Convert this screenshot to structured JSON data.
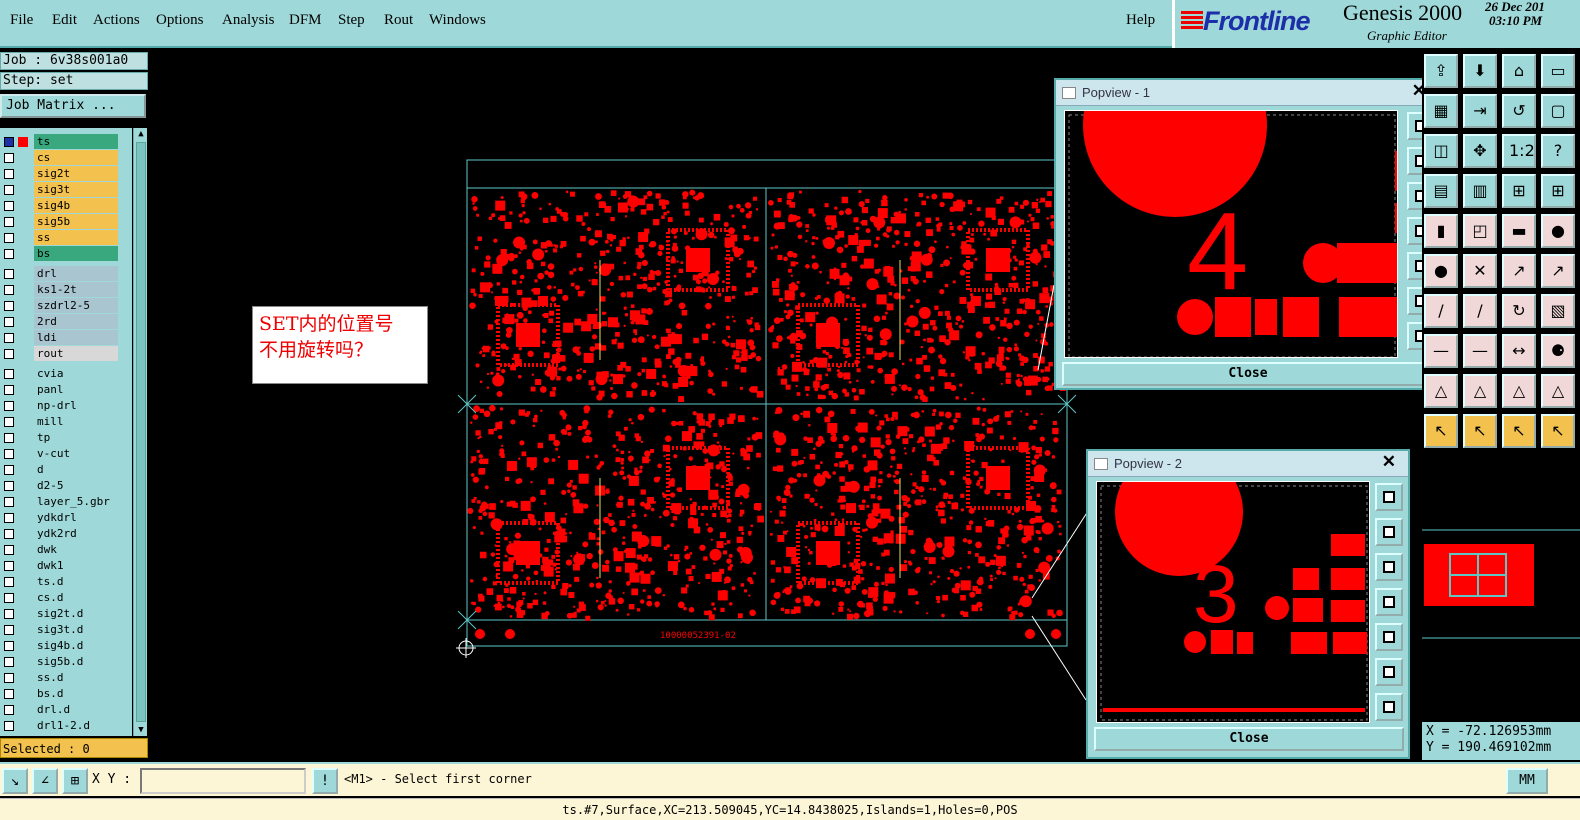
{
  "menu": {
    "items": [
      "File",
      "Edit",
      "Actions",
      "Options",
      "Analysis",
      "DFM",
      "Step",
      "Rout",
      "Windows"
    ],
    "help": "Help"
  },
  "brand": {
    "logo": "Frontline",
    "product": "Genesis 2000",
    "subtitle": "Graphic Editor",
    "date": "26 Dec 201",
    "time": "03:10 PM"
  },
  "job": {
    "job_line": "Job : 6v38s001a0",
    "step_line": "Step: set",
    "matrix_button": "Job Matrix ..."
  },
  "layers": [
    {
      "name": "ts",
      "color": "#3aa87e"
    },
    {
      "name": "cs",
      "color": "#f2c14e"
    },
    {
      "name": "sig2t",
      "color": "#f2c14e"
    },
    {
      "name": "sig3t",
      "color": "#f2c14e"
    },
    {
      "name": "sig4b",
      "color": "#f2c14e"
    },
    {
      "name": "sig5b",
      "color": "#f2c14e"
    },
    {
      "name": "ss",
      "color": "#f2c14e"
    },
    {
      "name": "bs",
      "color": "#3aa87e"
    },
    {
      "name": "drl",
      "color": "#a9c6d0"
    },
    {
      "name": "ks1-2t",
      "color": "#a9c6d0"
    },
    {
      "name": "szdrl2-5",
      "color": "#a9c6d0"
    },
    {
      "name": "2rd",
      "color": "#a9c6d0"
    },
    {
      "name": "ldi",
      "color": "#a9c6d0"
    },
    {
      "name": "rout",
      "color": "#d8d8d8"
    },
    {
      "name": "cvia",
      "color": "#9ed8d8"
    },
    {
      "name": "panl",
      "color": "#9ed8d8"
    },
    {
      "name": "np-drl",
      "color": "#9ed8d8"
    },
    {
      "name": "mill",
      "color": "#9ed8d8"
    },
    {
      "name": "tp",
      "color": "#9ed8d8"
    },
    {
      "name": "v-cut",
      "color": "#9ed8d8"
    },
    {
      "name": "d",
      "color": "#9ed8d8"
    },
    {
      "name": "d2-5",
      "color": "#9ed8d8"
    },
    {
      "name": "layer_5.gbr",
      "color": "#9ed8d8"
    },
    {
      "name": "ydkdrl",
      "color": "#9ed8d8"
    },
    {
      "name": "ydk2rd",
      "color": "#9ed8d8"
    },
    {
      "name": "dwk",
      "color": "#9ed8d8"
    },
    {
      "name": "dwk1",
      "color": "#9ed8d8"
    },
    {
      "name": "ts.d",
      "color": "#9ed8d8"
    },
    {
      "name": "cs.d",
      "color": "#9ed8d8"
    },
    {
      "name": "sig2t.d",
      "color": "#9ed8d8"
    },
    {
      "name": "sig3t.d",
      "color": "#9ed8d8"
    },
    {
      "name": "sig4b.d",
      "color": "#9ed8d8"
    },
    {
      "name": "sig5b.d",
      "color": "#9ed8d8"
    },
    {
      "name": "ss.d",
      "color": "#9ed8d8"
    },
    {
      "name": "bs.d",
      "color": "#9ed8d8"
    },
    {
      "name": "drl.d",
      "color": "#9ed8d8"
    },
    {
      "name": "drl1-2.d",
      "color": "#9ed8d8"
    }
  ],
  "selected_text": "Selected : 0",
  "note": {
    "line1": "SET内的位置号",
    "line2": "不用旋转吗？"
  },
  "board": {
    "label": "10000052391-02"
  },
  "popview1": {
    "title": "Popview - 1",
    "close_label": "Close",
    "digit": "4"
  },
  "popview2": {
    "title": "Popview - 2",
    "close_label": "Close",
    "digit": "3"
  },
  "coords": {
    "x": "X = -72.126953mm",
    "y": "Y = 190.469102mm"
  },
  "command": {
    "xy_label": "X Y :",
    "xy_value": "",
    "message": "<M1> - Select first corner",
    "units": "MM"
  },
  "status_text": "ts.#7,Surface,XC=213.509045,YC=14.8438025,Islands=1,Holes=0,POS",
  "colors": {
    "panel": "#9ed8d8",
    "copper": "#ff0000",
    "outline": "#5fc6c6",
    "highlight": "#f2c14e"
  }
}
